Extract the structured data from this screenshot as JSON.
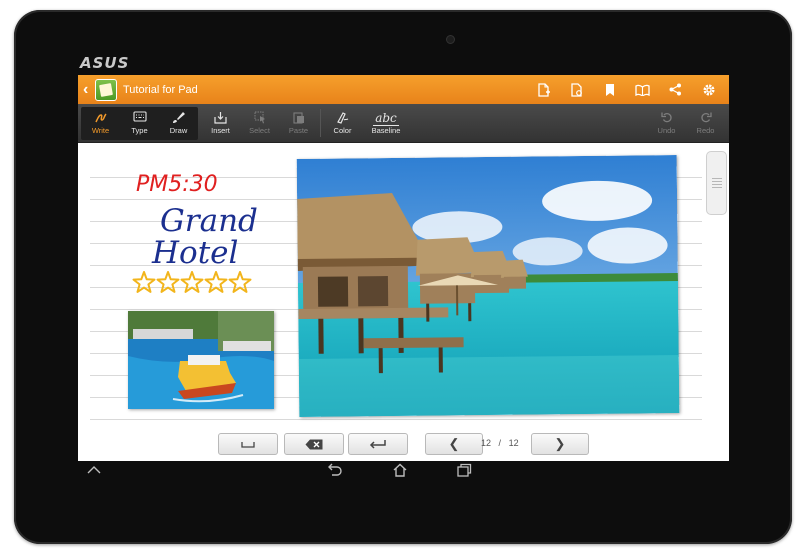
{
  "device": {
    "brand": "ASUS"
  },
  "actionbar": {
    "title": "Tutorial for Pad",
    "icons": [
      "add-page-icon",
      "page-settings-icon",
      "bookmark-icon",
      "book-icon",
      "share-icon",
      "gear-icon"
    ]
  },
  "toolbar": {
    "modes": [
      {
        "name": "write",
        "label": "Write",
        "glyph": "✎",
        "active": true
      },
      {
        "name": "type",
        "label": "Type",
        "glyph": "⌨",
        "active": false
      },
      {
        "name": "draw",
        "label": "Draw",
        "glyph": "✏",
        "active": false
      }
    ],
    "insert_label": "Insert",
    "select_label": "Select",
    "paste_label": "Paste",
    "color_label": "Color",
    "baseline_label": "Baseline",
    "baseline_glyph": "abc",
    "undo_label": "Undo",
    "redo_label": "Redo"
  },
  "note": {
    "handwritten_time": "PM5:30",
    "handwritten_line1": "Grand",
    "handwritten_line2": "Hotel",
    "stars": 5
  },
  "pager": {
    "current": "12",
    "separator": "/",
    "total": "12"
  },
  "colors": {
    "accent": "#f39a2a",
    "actionbar": "#ef8f22",
    "toolbar": "#3b3b3b",
    "handwriting_red": "#e02020",
    "handwriting_blue": "#1b2f8f",
    "star": "#f2b51c"
  }
}
